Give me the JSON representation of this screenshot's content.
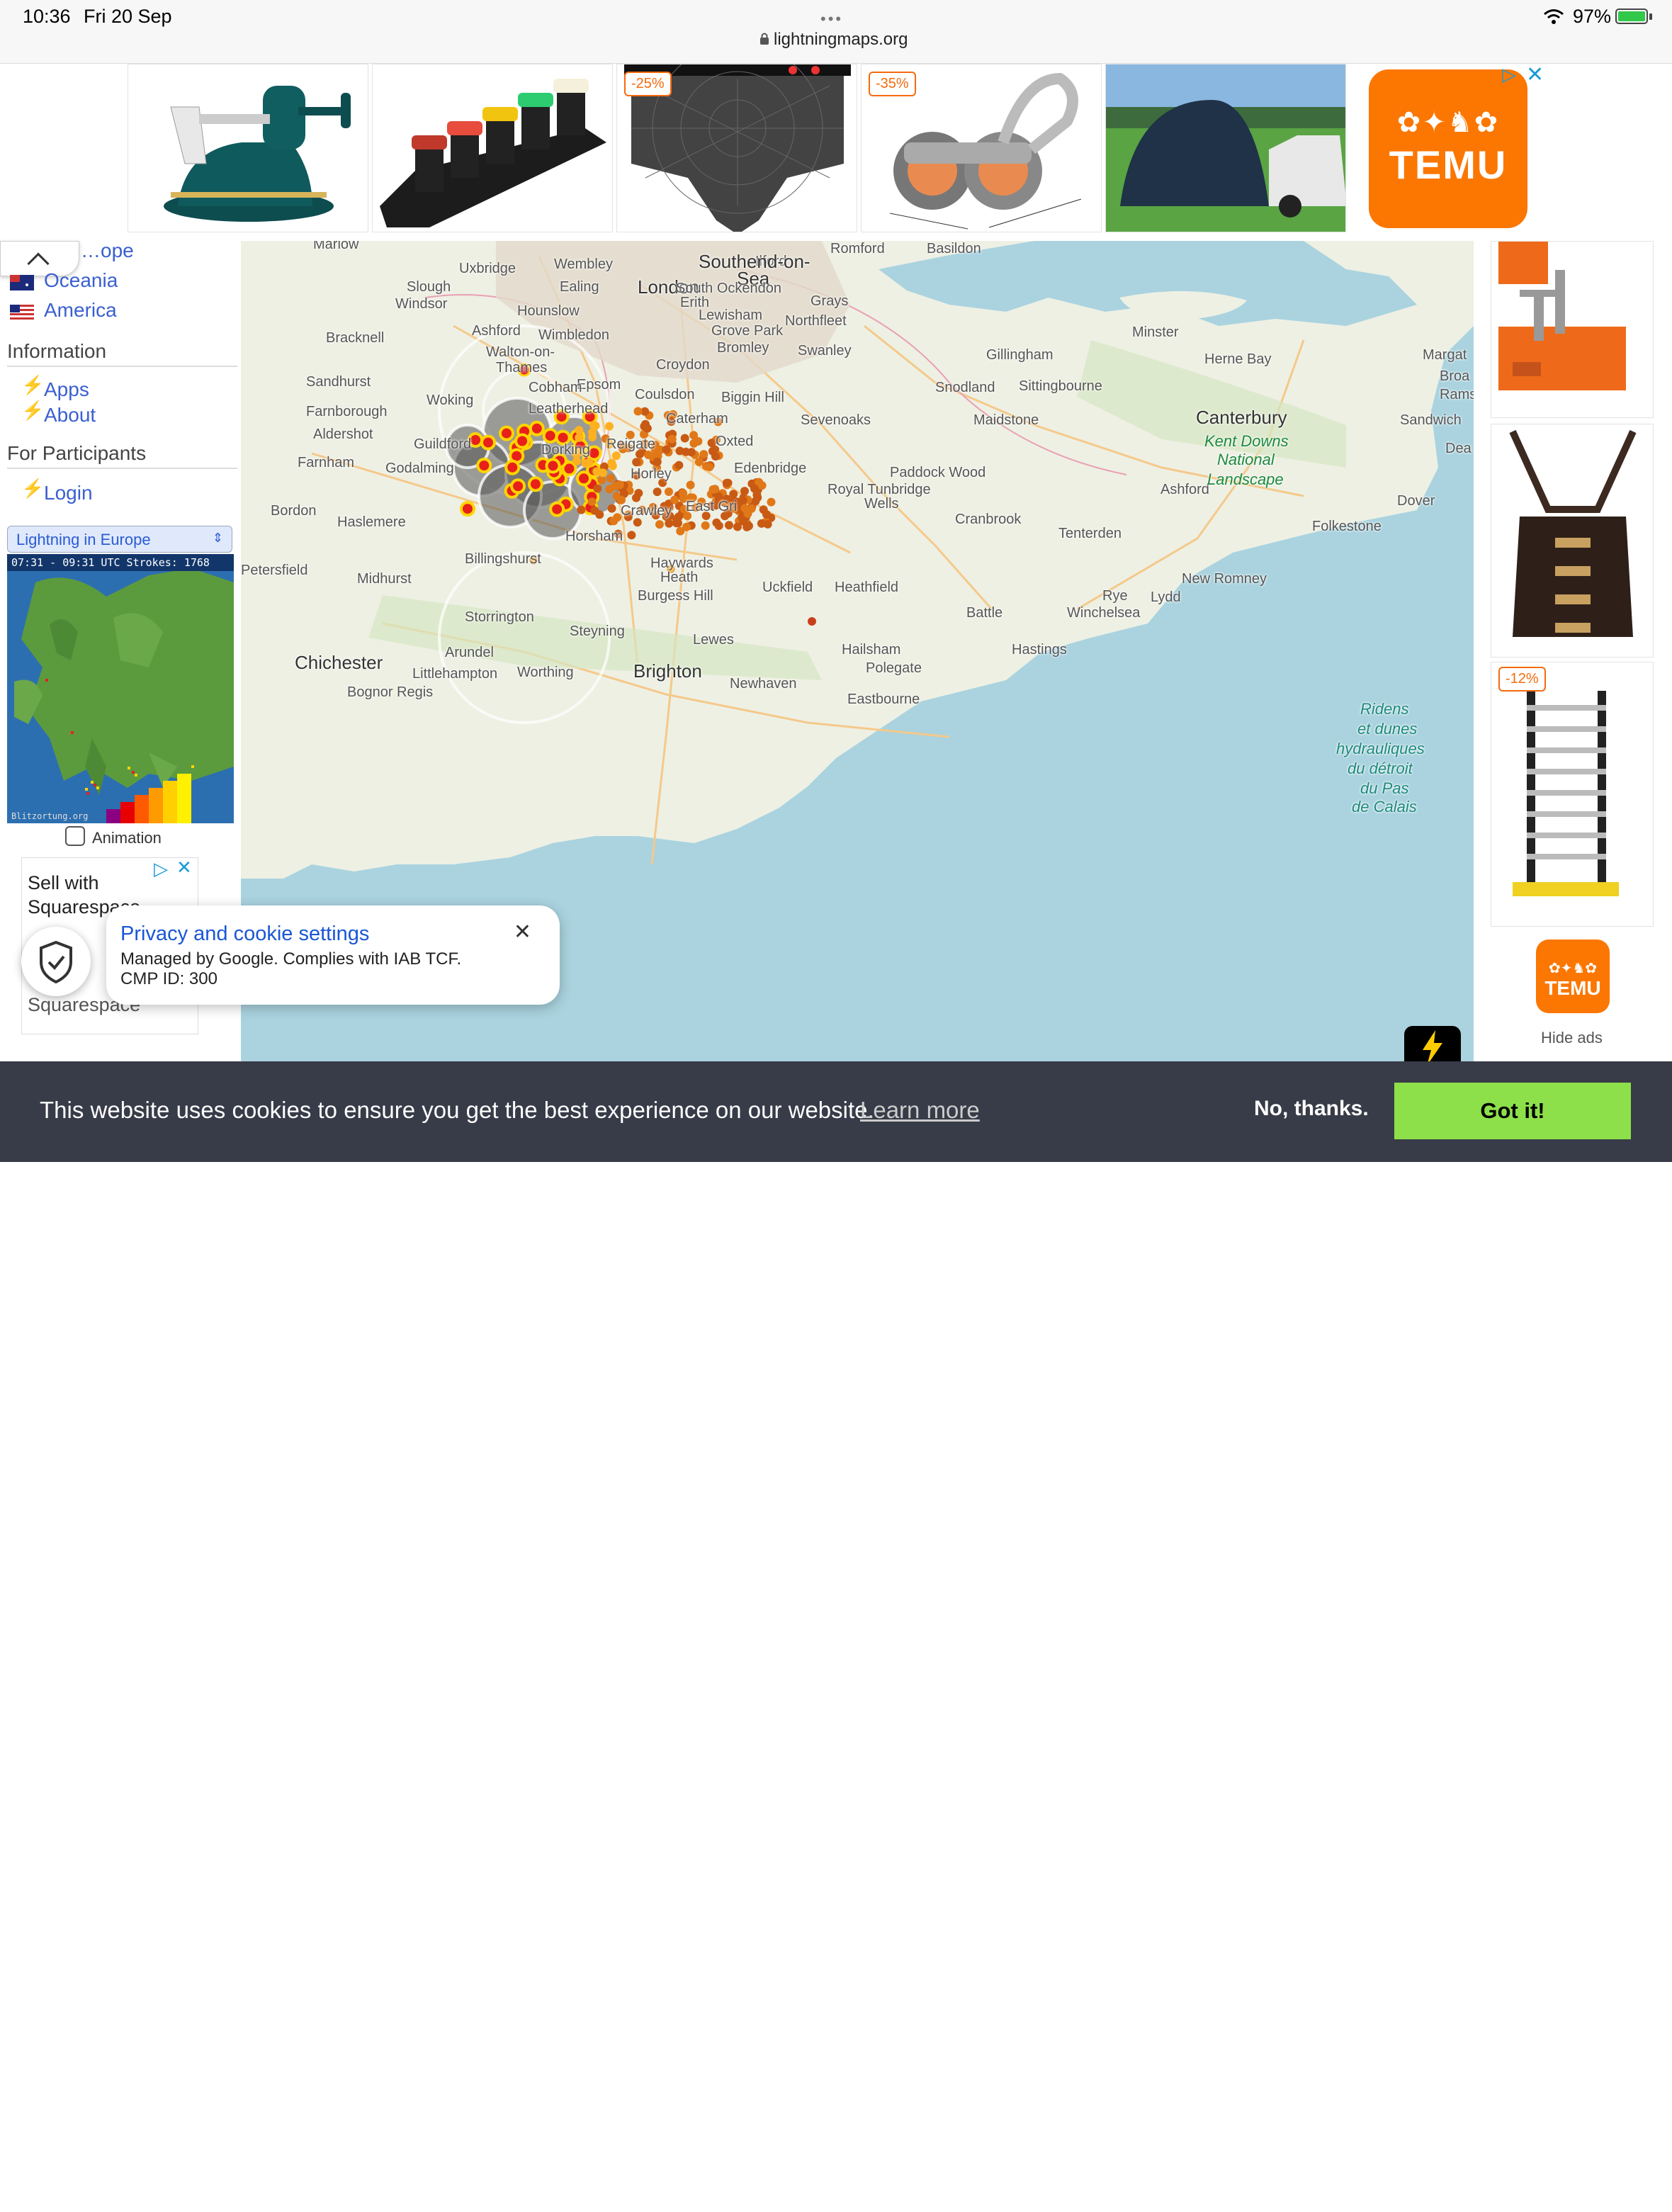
{
  "status": {
    "time": "10:36",
    "date": "Fri 20 Sep",
    "url": "lightningmaps.org",
    "battery": "97%"
  },
  "top_ads": {
    "discounts": [
      "-25%",
      "-35%"
    ],
    "brand": "TEMU"
  },
  "sidebar": {
    "regions": [
      "…ope",
      "Oceania",
      "America"
    ],
    "info_heading": "Information",
    "info_links": [
      "Apps",
      "About"
    ],
    "participants_heading": "For Participants",
    "login": "Login",
    "region_select": "Lightning in Europe",
    "mini_map_header": "07:31 - 09:31 UTC Strokes: 1768",
    "mini_map_watermark": "Blitzortung.org",
    "animation_label": "Animation",
    "square_ad": {
      "line1": "Sell with",
      "line2": "Squarespace",
      "bottom": "Squarespace"
    }
  },
  "map": {
    "labels": [
      {
        "t": "Marlow",
        "c": ""
      },
      {
        "t": "Uxbridge",
        "c": ""
      },
      {
        "t": "Wembley",
        "c": ""
      },
      {
        "t": "Ilford",
        "c": ""
      },
      {
        "t": "Romford",
        "c": ""
      },
      {
        "t": "Basildon",
        "c": ""
      },
      {
        "t": "Southend-on-",
        "c": "big"
      },
      {
        "t": "Sea",
        "c": "big"
      },
      {
        "t": "Slough",
        "c": ""
      },
      {
        "t": "Windsor",
        "c": ""
      },
      {
        "t": "Ealing",
        "c": ""
      },
      {
        "t": "London",
        "c": "big"
      },
      {
        "t": "South Ockendon",
        "c": ""
      },
      {
        "t": "Grays",
        "c": ""
      },
      {
        "t": "Erith",
        "c": ""
      },
      {
        "t": "Hounslow",
        "c": ""
      },
      {
        "t": "Lewisham",
        "c": ""
      },
      {
        "t": "Northfleet",
        "c": ""
      },
      {
        "t": "Ashford",
        "c": ""
      },
      {
        "t": "Bracknell",
        "c": ""
      },
      {
        "t": "Wimbledon",
        "c": ""
      },
      {
        "t": "Grove Park",
        "c": ""
      },
      {
        "t": "Minster",
        "c": ""
      },
      {
        "t": "Walton-on-",
        "c": ""
      },
      {
        "t": "Thames",
        "c": ""
      },
      {
        "t": "Bromley",
        "c": ""
      },
      {
        "t": "Swanley",
        "c": ""
      },
      {
        "t": "Gillingham",
        "c": ""
      },
      {
        "t": "Herne Bay",
        "c": ""
      },
      {
        "t": "Margat",
        "c": ""
      },
      {
        "t": "Croydon",
        "c": ""
      },
      {
        "t": "Broa",
        "c": ""
      },
      {
        "t": "Sandhurst",
        "c": ""
      },
      {
        "t": "Epsom",
        "c": ""
      },
      {
        "t": "Sittingbourne",
        "c": ""
      },
      {
        "t": "Rams",
        "c": ""
      },
      {
        "t": "Woking",
        "c": ""
      },
      {
        "t": "Cobham",
        "c": ""
      },
      {
        "t": "Coulsdon",
        "c": ""
      },
      {
        "t": "Biggin Hill",
        "c": ""
      },
      {
        "t": "Snodland",
        "c": ""
      },
      {
        "t": "Farnborough",
        "c": ""
      },
      {
        "t": "Leatherhead",
        "c": ""
      },
      {
        "t": "Caterham",
        "c": ""
      },
      {
        "t": "Sevenoaks",
        "c": ""
      },
      {
        "t": "Maidstone",
        "c": ""
      },
      {
        "t": "Canterbury",
        "c": "big"
      },
      {
        "t": "Sandwich",
        "c": ""
      },
      {
        "t": "Aldershot",
        "c": ""
      },
      {
        "t": "Oxted",
        "c": ""
      },
      {
        "t": "Guildford",
        "c": ""
      },
      {
        "t": "Dorking",
        "c": ""
      },
      {
        "t": "Reigate",
        "c": ""
      },
      {
        "t": "Farnham",
        "c": ""
      },
      {
        "t": "Edenbridge",
        "c": ""
      },
      {
        "t": "Dea",
        "c": ""
      },
      {
        "t": "Godalming",
        "c": ""
      },
      {
        "t": "Paddock Wood",
        "c": ""
      },
      {
        "t": "Horley",
        "c": ""
      },
      {
        "t": "Royal Tunbridge",
        "c": ""
      },
      {
        "t": "Wells",
        "c": ""
      },
      {
        "t": "Ashford",
        "c": ""
      },
      {
        "t": "East Gri",
        "c": ""
      },
      {
        "t": "Bordon",
        "c": ""
      },
      {
        "t": "Crawley",
        "c": ""
      },
      {
        "t": "Dover",
        "c": ""
      },
      {
        "t": "Haslemere",
        "c": ""
      },
      {
        "t": "Cranbrook",
        "c": ""
      },
      {
        "t": "Folkestone",
        "c": ""
      },
      {
        "t": "Horsham",
        "c": ""
      },
      {
        "t": "Tenterden",
        "c": ""
      },
      {
        "t": "Billingshurst",
        "c": ""
      },
      {
        "t": "Haywards",
        "c": ""
      },
      {
        "t": "Heath",
        "c": ""
      },
      {
        "t": "Uckfield",
        "c": ""
      },
      {
        "t": "Heathfield",
        "c": ""
      },
      {
        "t": "New Romney",
        "c": ""
      },
      {
        "t": "Midhurst",
        "c": ""
      },
      {
        "t": "Petersfield",
        "c": ""
      },
      {
        "t": "Burgess Hill",
        "c": ""
      },
      {
        "t": "Rye",
        "c": ""
      },
      {
        "t": "Lydd",
        "c": ""
      },
      {
        "t": "Storrington",
        "c": ""
      },
      {
        "t": "Battle",
        "c": ""
      },
      {
        "t": "Winchelsea",
        "c": ""
      },
      {
        "t": "Steyning",
        "c": ""
      },
      {
        "t": "Lewes",
        "c": ""
      },
      {
        "t": "Hailsham",
        "c": ""
      },
      {
        "t": "Arundel",
        "c": ""
      },
      {
        "t": "Hastings",
        "c": ""
      },
      {
        "t": "Chichester",
        "c": "big"
      },
      {
        "t": "Brighton",
        "c": "big"
      },
      {
        "t": "Polegate",
        "c": ""
      },
      {
        "t": "Littlehampton",
        "c": ""
      },
      {
        "t": "Worthing",
        "c": ""
      },
      {
        "t": "Newhaven",
        "c": ""
      },
      {
        "t": "Bognor Regis",
        "c": ""
      },
      {
        "t": "Eastbourne",
        "c": ""
      },
      {
        "t": "Kent Downs",
        "c": "park"
      },
      {
        "t": "National",
        "c": "park"
      },
      {
        "t": "Landscape",
        "c": "park"
      },
      {
        "t": "Ridens",
        "c": "sea"
      },
      {
        "t": "et dunes",
        "c": "sea"
      },
      {
        "t": "hydrauliques",
        "c": "sea"
      },
      {
        "t": "du détroit",
        "c": "sea"
      },
      {
        "t": "du Pas",
        "c": "sea"
      },
      {
        "t": "de Calais",
        "c": "sea"
      }
    ]
  },
  "right_ads": {
    "discount": "-12%",
    "brand": "TEMU",
    "hide_ads": "Hide ads"
  },
  "privacy": {
    "title": "Privacy and cookie settings",
    "line1": "Managed by Google. Complies with IAB TCF.",
    "line2": "CMP ID: 300"
  },
  "cookie": {
    "text": "This website uses cookies to ensure you get the best experience on our website.",
    "learn_more": "Learn more",
    "decline": "No, thanks.",
    "accept": "Got it!"
  },
  "colors": {
    "sea": "#aad3df",
    "land": "#eef0e4",
    "temu_orange": "#fb7701",
    "cookie_bar": "#383b48",
    "accept_green": "#8ee04a",
    "link_blue": "#3a5fd0",
    "strike_red": "#e8201a",
    "strike_yellow": "#ffd400",
    "strike_orange": "#d86a10"
  }
}
